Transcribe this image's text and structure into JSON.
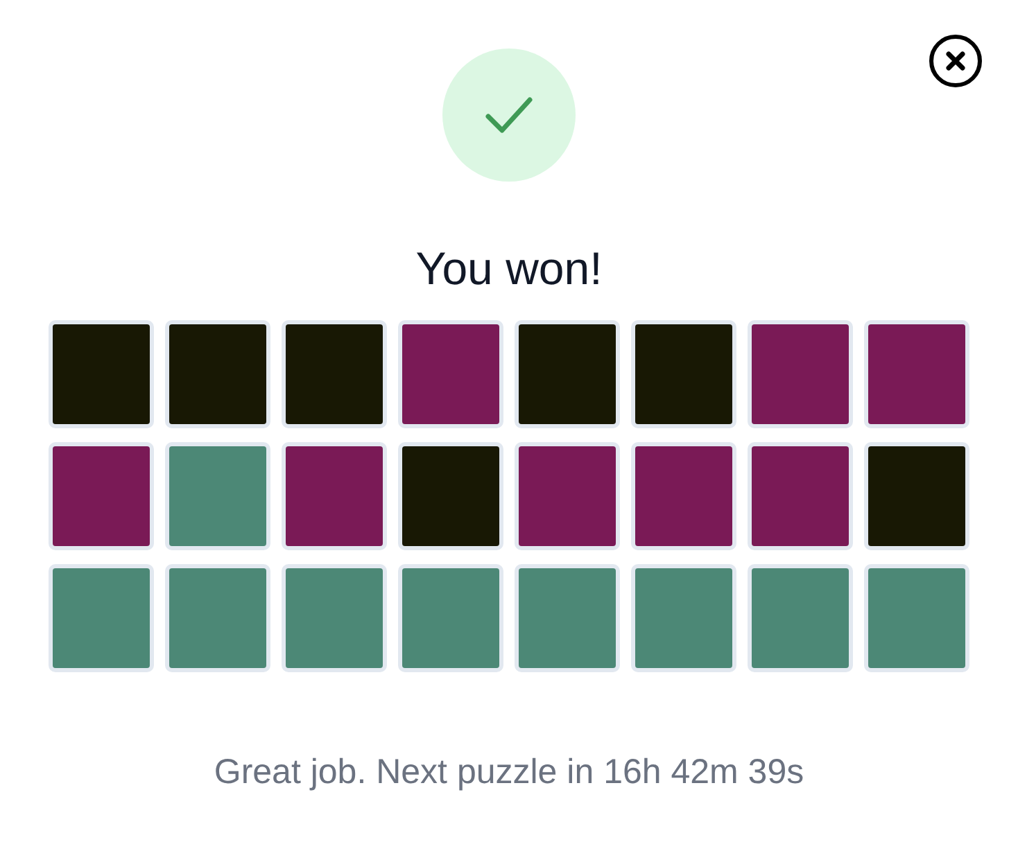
{
  "title": "You won!",
  "rows": [
    {
      "tiles": [
        {
          "color": "#181804"
        },
        {
          "color": "#181804"
        },
        {
          "color": "#181804"
        },
        {
          "color": "#7a1a56"
        },
        {
          "color": "#181804"
        },
        {
          "color": "#181804"
        },
        {
          "color": "#7a1a56"
        },
        {
          "color": "#7a1a56"
        }
      ]
    },
    {
      "tiles": [
        {
          "color": "#7a1a56"
        },
        {
          "color": "#4c8876"
        },
        {
          "color": "#7a1a56"
        },
        {
          "color": "#181804"
        },
        {
          "color": "#7a1a56"
        },
        {
          "color": "#7a1a56"
        },
        {
          "color": "#7a1a56"
        },
        {
          "color": "#181804"
        }
      ]
    },
    {
      "tiles": [
        {
          "color": "#4c8876"
        },
        {
          "color": "#4c8876"
        },
        {
          "color": "#4c8876"
        },
        {
          "color": "#4c8876"
        },
        {
          "color": "#4c8876"
        },
        {
          "color": "#4c8876"
        },
        {
          "color": "#4c8876"
        },
        {
          "color": "#4c8876"
        }
      ]
    }
  ],
  "message": "Great job. Next puzzle in 16h 42m 39s"
}
